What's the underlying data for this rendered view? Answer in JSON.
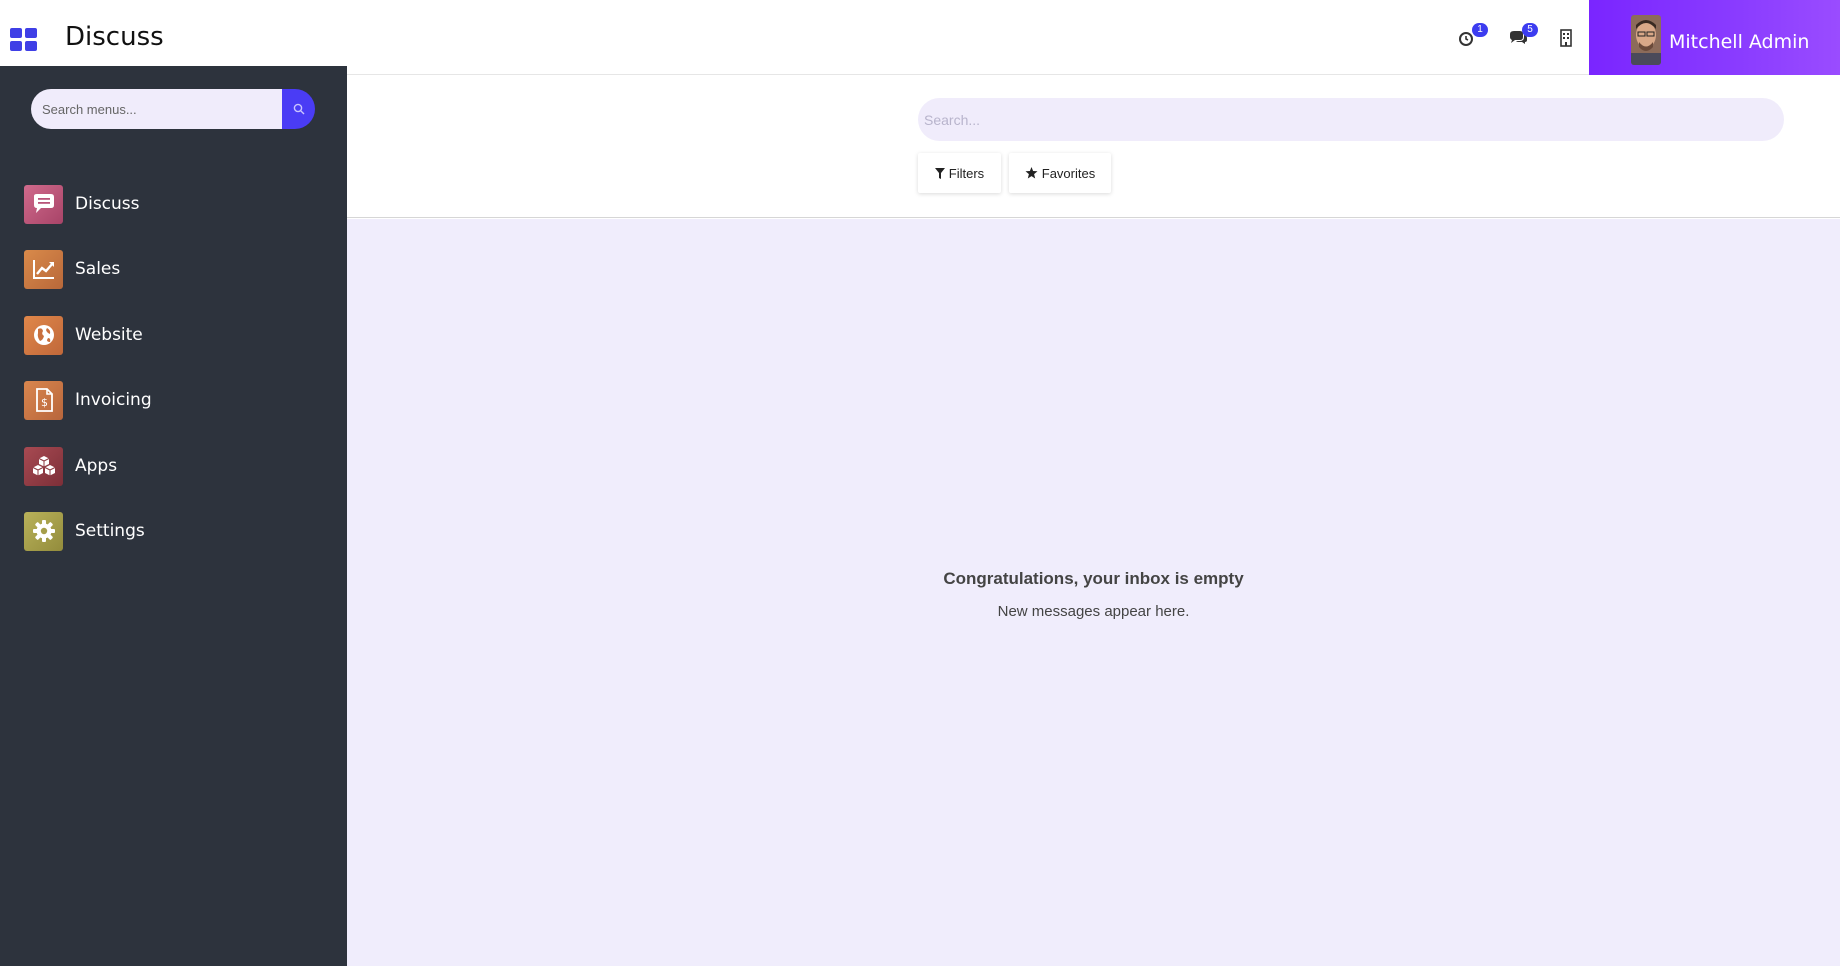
{
  "navbar": {
    "app_title": "Discuss",
    "activity_badge": "1",
    "messages_badge": "5",
    "user_name": "Mitchell Admin"
  },
  "control_panel": {
    "search_placeholder": "Search...",
    "filters_label": "Filters",
    "favorites_label": "Favorites"
  },
  "content": {
    "empty_title": "Congratulations, your inbox is empty",
    "empty_subtitle": "New messages appear here."
  },
  "sidebar": {
    "search_placeholder": "Search menus...",
    "items": [
      {
        "label": "Discuss",
        "icon": "chat-bubble-icon",
        "color": "#c0577a"
      },
      {
        "label": "Sales",
        "icon": "trending-chart-icon",
        "color": "#c87a3a"
      },
      {
        "label": "Website",
        "icon": "globe-icon",
        "color": "#d0743c"
      },
      {
        "label": "Invoicing",
        "icon": "invoice-dollar-icon",
        "color": "#c4703e"
      },
      {
        "label": "Apps",
        "icon": "cubes-icon",
        "color": "#9a3d45"
      },
      {
        "label": "Settings",
        "icon": "gear-icon",
        "color": "#a9a14a"
      }
    ]
  },
  "colors": {
    "accent": "#3f3fe6",
    "user_gradient_start": "#7a25ff",
    "sidebar_bg": "#2d333d",
    "content_bg": "#f0edfc"
  }
}
